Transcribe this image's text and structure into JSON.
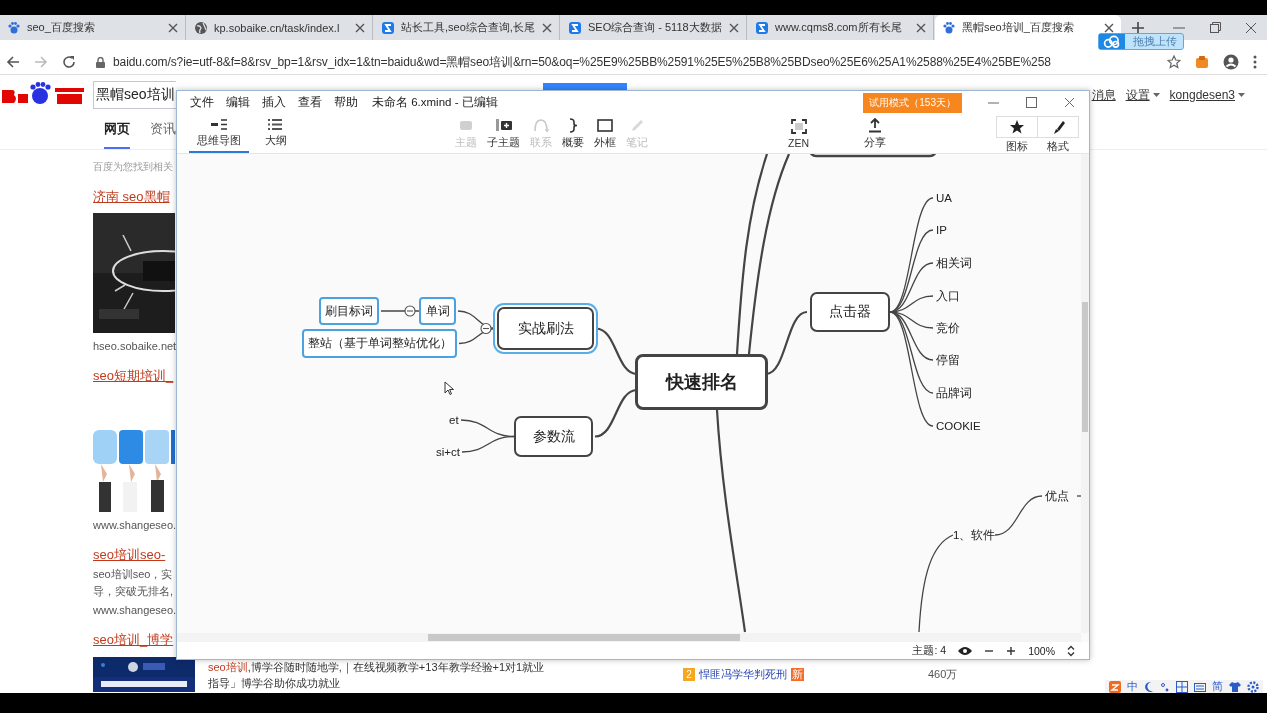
{
  "browser": {
    "tabs": [
      {
        "title": "seo_百度搜索",
        "selected": false
      },
      {
        "title": "kp.sobaike.cn/task/index.l",
        "selected": false
      },
      {
        "title": "站长工具,seo综合查询,长尾",
        "selected": false
      },
      {
        "title": "SEO综合查询 - 5118大数据",
        "selected": false
      },
      {
        "title": "www.cqms8.com所有长尾",
        "selected": false
      },
      {
        "title": "黑帽seo培训_百度搜索",
        "selected": true
      }
    ],
    "url": "baidu.com/s?ie=utf-8&f=8&rsv_bp=1&rsv_idx=1&tn=baidu&wd=黑帽seo培训&rn=50&oq=%25E9%25BB%2591%25E5%25B8%25BDseo%25E6%25A1%2588%25E4%25BE%258",
    "upload_widget": "拖拽上传"
  },
  "baidu": {
    "query": "黑帽seo培训",
    "top_links": [
      "消息",
      "设置",
      "kongdesen3"
    ],
    "tabs": [
      {
        "label": "网页",
        "selected": true
      },
      {
        "label": "资讯",
        "selected": false
      }
    ],
    "results": [
      {
        "kind": "count",
        "text": "百度为您找到相关"
      },
      {
        "kind": "title",
        "text": "济南 seo黑帽"
      },
      {
        "kind": "picture"
      },
      {
        "kind": "url",
        "text": "hseo.sobaike.net"
      },
      {
        "kind": "title",
        "text": "seo短期培训_"
      },
      {
        "kind": "picture"
      },
      {
        "kind": "url",
        "text": "www.shangeseo."
      },
      {
        "kind": "title",
        "text": "seo培训seo-"
      },
      {
        "kind": "snippet",
        "text": "seo培训seo，实"
      },
      {
        "kind": "snippet",
        "text": "导，突破无排名,"
      },
      {
        "kind": "url",
        "text": "www.shangeseo."
      },
      {
        "kind": "title",
        "text": "seo培训_博学"
      }
    ],
    "ad": {
      "text": "**seo培训**,博学谷随时随地学,｜在线视频教学+13年教学经验+1对1就业指导」博学谷助你成功就业"
    },
    "hot": {
      "rank": "2",
      "title": "悍匪冯学华判死刑",
      "badge": "新",
      "count": "460万"
    }
  },
  "xmind": {
    "menu": [
      "文件",
      "编辑",
      "插入",
      "查看",
      "帮助"
    ],
    "title": "未命名 6.xmind - 已编辑",
    "trial": "试用模式（153天）",
    "views": [
      {
        "label": "思维导图",
        "selected": true
      },
      {
        "label": "大纲",
        "selected": false
      }
    ],
    "tools": [
      {
        "label": "主题",
        "disabled": true
      },
      {
        "label": "子主题",
        "disabled": false
      },
      {
        "label": "联系",
        "disabled": true
      },
      {
        "label": "概要",
        "disabled": false
      },
      {
        "label": "外框",
        "disabled": false
      },
      {
        "label": "笔记",
        "disabled": true
      }
    ],
    "zen": "ZEN",
    "share": "分享",
    "panels": [
      "图标",
      "格式"
    ],
    "map": {
      "root": {
        "text": "快速排名",
        "kind": "central",
        "selected": false,
        "children": [
          {
            "text": "实战刷法",
            "kind": "main",
            "selected": true,
            "children": [
              {
                "text": "单词",
                "kind": "sub",
                "selected": true,
                "children": [
                  {
                    "text": "刷目标词",
                    "kind": "sub",
                    "selected": true
                  }
                ]
              },
              {
                "text": "整站（基于单词整站优化）",
                "kind": "sub",
                "selected": true
              }
            ]
          },
          {
            "text": "参数流",
            "kind": "main",
            "selected": false,
            "children": [
              {
                "text": "et",
                "kind": "label",
                "selected": false
              },
              {
                "text": "si+ct",
                "kind": "label",
                "selected": false
              }
            ]
          },
          {
            "text": "点击器",
            "kind": "main",
            "selected": false,
            "children": [
              {
                "text": "UA",
                "kind": "label",
                "selected": false
              },
              {
                "text": "IP",
                "kind": "label",
                "selected": false
              },
              {
                "text": "相关词",
                "kind": "label",
                "selected": false
              },
              {
                "text": "入口",
                "kind": "label",
                "selected": false
              },
              {
                "text": "竞价",
                "kind": "label",
                "selected": false
              },
              {
                "text": "停留",
                "kind": "label",
                "selected": false
              },
              {
                "text": "品牌词",
                "kind": "label",
                "selected": false
              },
              {
                "text": "COOKIE",
                "kind": "label",
                "selected": false
              }
            ]
          }
        ]
      },
      "other": [
        {
          "text": "1、软件",
          "kind": "label",
          "selected": false,
          "children": [
            {
              "text": "优点",
              "kind": "label",
              "selected": false
            }
          ]
        }
      ]
    },
    "status": {
      "topics": "主题: 4",
      "zoom": "100%"
    }
  },
  "ime": {
    "mode": "中",
    "script": "简"
  }
}
